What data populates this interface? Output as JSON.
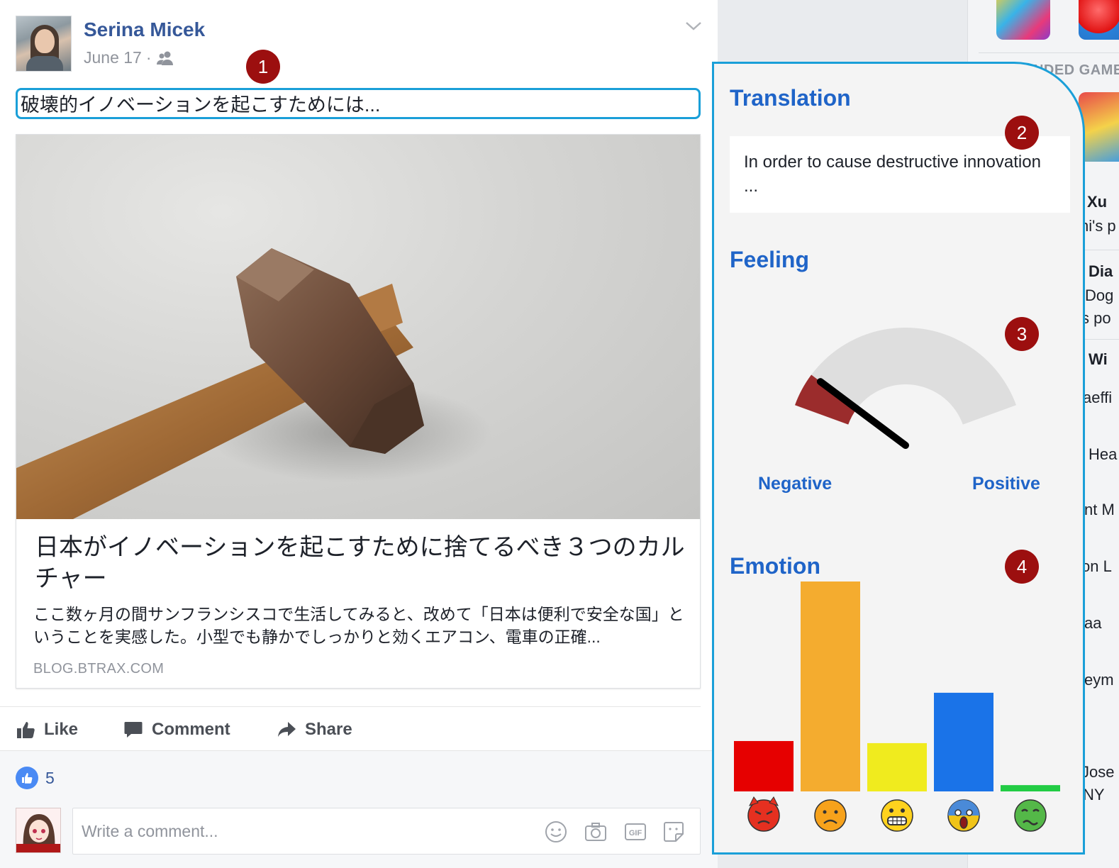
{
  "post": {
    "author": "Serina Micek",
    "date": "June 17",
    "date_separator": "·",
    "privacy_icon": "friends-icon",
    "menu_icon": "chevron-down-icon",
    "text": "破壊的イノベーションを起こすためには...",
    "link": {
      "title": "日本がイノベーションを起こすために捨てるべき３つのカルチャー",
      "description": "ここ数ヶ月の間サンフランシスコで生活してみると、改めて「日本は便利で安全な国」ということを実感した。小型でも静かでしっかりと効くエアコン、電車の正確...",
      "domain": "BLOG.BTRAX.COM"
    },
    "actions": {
      "like": "Like",
      "comment": "Comment",
      "share": "Share"
    },
    "like_count": "5",
    "comment_placeholder": "Write a comment..."
  },
  "badges": [
    "1",
    "2",
    "3",
    "4"
  ],
  "panel": {
    "translation_heading": "Translation",
    "translation_text": "In order to cause destructive innovation ...",
    "feeling_heading": "Feeling",
    "feeling_negative_label": "Negative",
    "feeling_positive_label": "Positive",
    "emotion_heading": "Emotion"
  },
  "chart_data": {
    "type": "bar",
    "categories": [
      "angry",
      "sad",
      "joy",
      "fear",
      "disgust"
    ],
    "category_icons": [
      "angry-devil-emoji-icon",
      "sad-face-emoji-icon",
      "grimace-face-emoji-icon",
      "scream-face-emoji-icon",
      "nauseated-face-emoji-icon"
    ],
    "values": [
      0.24,
      1.0,
      0.23,
      0.47,
      0.03
    ],
    "colors": [
      "#e60000",
      "#f4ac2f",
      "#f0eb1e",
      "#1a73e8",
      "#22cc44"
    ],
    "ylim": [
      0,
      1
    ]
  },
  "feeling_gauge": {
    "value": 0.12,
    "range": [
      0,
      1
    ],
    "fill_color": "#9b2c2c",
    "track_color": "#dedede",
    "needle_color": "#000000"
  },
  "sidebar": {
    "section_label": "RECOMMENDED GAMES",
    "items": [
      "Xu",
      "hi's p",
      "Dia",
      "Dog",
      "s po",
      "Wi",
      "aeffi",
      "Hea",
      "nt M",
      "on L",
      "aa",
      "eym",
      "Jose",
      "NY"
    ]
  }
}
